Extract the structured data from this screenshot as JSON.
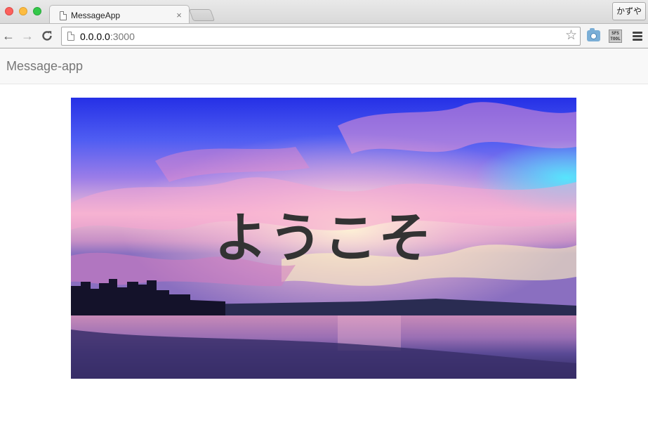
{
  "browser": {
    "tab_title": "MessageApp",
    "tab_close": "×",
    "profile_name": "かずや",
    "url_host": "0.0.0.0",
    "url_port": ":3000",
    "ext_label_1": "SFS",
    "ext_label_2": "TOOL",
    "icons": {
      "back": "←",
      "forward": "→",
      "reload": "C",
      "star": "☆"
    }
  },
  "navbar": {
    "brand": "Message-app"
  },
  "hero": {
    "title": "ようこそ"
  },
  "colors": {
    "navbar_bg": "#f8f8f8",
    "brand_text": "#777777",
    "hero_text": "#333333"
  }
}
